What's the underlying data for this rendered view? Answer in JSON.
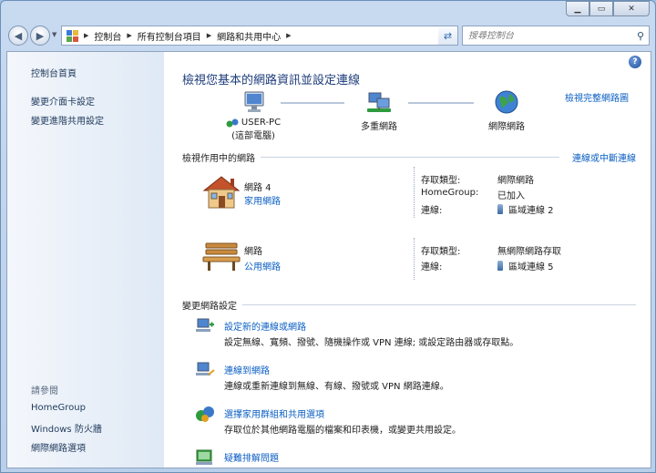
{
  "address": {
    "crumbs": [
      "控制台",
      "所有控制台項目",
      "網路和共用中心"
    ],
    "search_placeholder": "搜尋控制台"
  },
  "sidebar": {
    "home": "控制台首頁",
    "links": [
      "變更介面卡設定",
      "變更進階共用設定"
    ],
    "see_also_title": "請參閱",
    "see_also": [
      "HomeGroup",
      "Windows 防火牆",
      "網際網路選項"
    ]
  },
  "main": {
    "title": "檢視您基本的網路資訊並設定連線",
    "full_map_link": "檢視完整網路圖",
    "map": {
      "computer_name": "USER-PC",
      "computer_sub": "(這部電腦)",
      "network": "多重網路",
      "internet": "網際網路"
    },
    "active_head": "檢視作用中的網路",
    "connect_link": "連線或中斷連線",
    "networks": [
      {
        "name": "網路  4",
        "type": "家用網路",
        "props": [
          {
            "label": "存取類型:",
            "value": "網際網路",
            "link": false
          },
          {
            "label": "HomeGroup:",
            "value": "已加入",
            "link": true
          },
          {
            "label": "連線:",
            "value": "區域連線 2",
            "link": true
          }
        ]
      },
      {
        "name": "網路",
        "type": "公用網路",
        "props": [
          {
            "label": "存取類型:",
            "value": "無網際網路存取",
            "link": false
          },
          {
            "label": "連線:",
            "value": "區域連線 5",
            "link": true
          }
        ]
      }
    ],
    "change_head": "變更網路設定",
    "tasks": [
      {
        "link": "設定新的連線或網路",
        "desc": "設定無線、寬頻、撥號、隨機操作或 VPN 連線; 或設定路由器或存取點。"
      },
      {
        "link": "連線到網路",
        "desc": "連線或重新連線到無線、有線、撥號或 VPN 網路連線。"
      },
      {
        "link": "選擇家用群組和共用選項",
        "desc": "存取位於其他網路電腦的檔案和印表機，或變更共用設定。"
      },
      {
        "link": "疑難排解問題",
        "desc": ""
      }
    ]
  },
  "colors": {
    "link": "#0b5fc3",
    "title": "#1e3d7b",
    "sidebar_link": "#1e395b"
  }
}
